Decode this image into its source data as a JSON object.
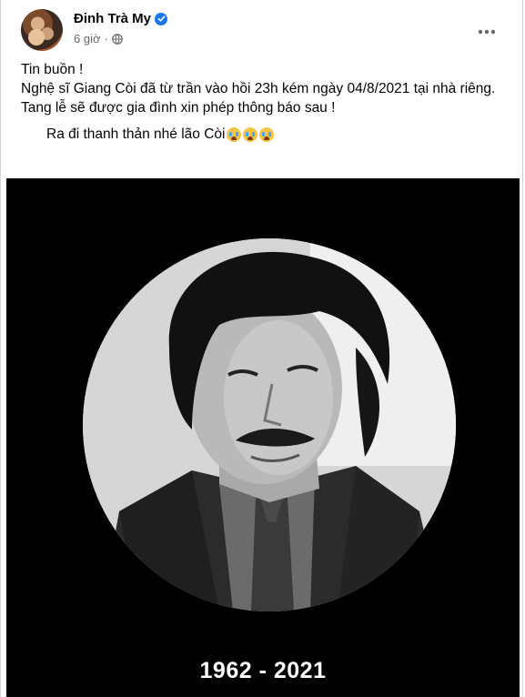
{
  "post": {
    "author": "Đinh Trà My",
    "time": "6 giờ",
    "time_separator": "·",
    "privacy_icon": "globe-icon",
    "verified_icon": "verified-badge-icon",
    "more_icon": "more-options-icon",
    "lines": [
      "Tin buồn !",
      "Nghệ sĩ Giang Còi đã từ trần vào hồi 23h kém ngày 04/8/2021 tại nhà riêng.",
      "Tang lễ sẽ được gia đình xin phép thông báo sau !"
    ],
    "farewell": "Ra đi thanh thản nhé lão Còi",
    "farewell_emoji_count": 3,
    "farewell_emoji_icon": "crying-face-icon"
  },
  "photo": {
    "years": "1962 - 2021",
    "background_color": "#000000"
  },
  "colors": {
    "verified": "#1877f2",
    "meta_text": "#65676b",
    "body_text": "#050505"
  }
}
